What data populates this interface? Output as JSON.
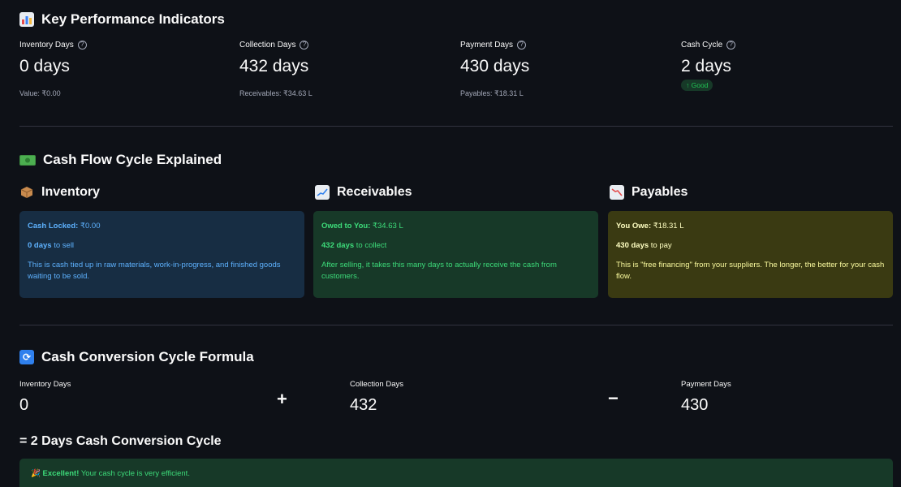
{
  "kpi_section": {
    "title": "Key Performance Indicators",
    "icon": "bar-chart-icon",
    "metrics": [
      {
        "label": "Inventory Days",
        "value": "0 days",
        "sub": "Value: ₹0.00"
      },
      {
        "label": "Collection Days",
        "value": "432 days",
        "sub": "Receivables: ₹34.63 L"
      },
      {
        "label": "Payment Days",
        "value": "430 days",
        "sub": "Payables: ₹18.31 L"
      },
      {
        "label": "Cash Cycle",
        "value": "2 days",
        "delta": "↑ Good"
      }
    ]
  },
  "cycle_section": {
    "title": "Cash Flow Cycle Explained",
    "icon": "money-icon",
    "cards": [
      {
        "heading": "Inventory",
        "icon": "package-icon",
        "line1_label": "Cash Locked:",
        "line1_value": "₹0.00",
        "line2_bold": "0 days",
        "line2_rest": "to sell",
        "description": "This is cash tied up in raw materials, work-in-progress, and finished goods waiting to be sold."
      },
      {
        "heading": "Receivables",
        "icon": "chart-increasing-icon",
        "line1_label": "Owed to You:",
        "line1_value": "₹34.63 L",
        "line2_bold": "432 days",
        "line2_rest": "to collect",
        "description": "After selling, it takes this many days to actually receive the cash from customers."
      },
      {
        "heading": "Payables",
        "icon": "chart-decreasing-icon",
        "line1_label": "You Owe:",
        "line1_value": "₹18.31 L",
        "line2_bold": "430 days",
        "line2_rest": "to pay",
        "description": "This is \"free financing\" from your suppliers. The longer, the better for your cash flow."
      }
    ]
  },
  "formula_section": {
    "title": "Cash Conversion Cycle Formula",
    "icon": "cycle-arrows-icon",
    "terms": [
      {
        "label": "Inventory Days",
        "value": "0"
      },
      {
        "label": "Collection Days",
        "value": "432"
      },
      {
        "label": "Payment Days",
        "value": "430"
      }
    ],
    "op_plus": "+",
    "op_minus": "−",
    "result": "= 2 Days Cash Conversion Cycle",
    "message_bold": "Excellent!",
    "message_rest": "Your cash cycle is very efficient."
  },
  "colors": {
    "background": "#0e1117",
    "info_blue": "#172d43",
    "success_green": "#173928",
    "warning_yellow": "#3a3a12"
  }
}
